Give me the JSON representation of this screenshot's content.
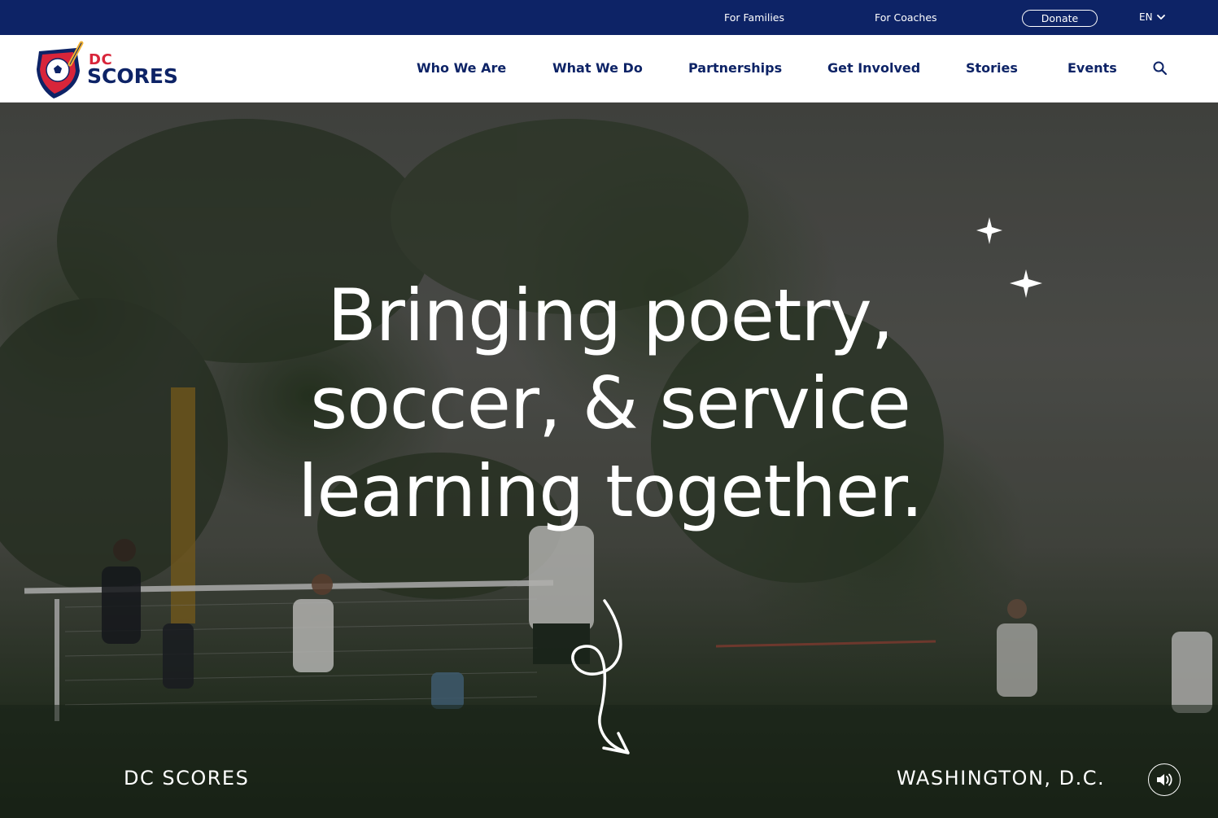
{
  "utility_bar": {
    "links": [
      "For Families",
      "For Coaches"
    ],
    "donate_label": "Donate",
    "language": "EN"
  },
  "brand": {
    "logo_dc": "DC",
    "logo_scores": "SCORES"
  },
  "nav": {
    "items": [
      "Who We Are",
      "What We Do",
      "Partnerships",
      "Get Involved",
      "Stories",
      "Events"
    ],
    "search_icon": "search-icon"
  },
  "hero": {
    "headline_lines": [
      "Bringing poetry,",
      "soccer, & service",
      "learning together."
    ],
    "left_caption": "DC SCORES",
    "right_caption": "WASHINGTON, D.C.",
    "sound_icon": "speaker-icon"
  },
  "colors": {
    "navy": "#0d2366",
    "red": "#d8253a",
    "white": "#ffffff"
  }
}
